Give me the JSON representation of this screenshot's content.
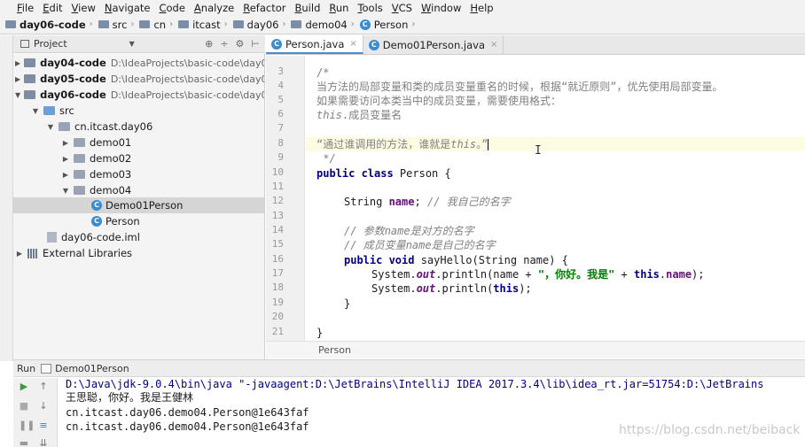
{
  "menu": [
    "File",
    "Edit",
    "View",
    "Navigate",
    "Code",
    "Analyze",
    "Refactor",
    "Build",
    "Run",
    "Tools",
    "VCS",
    "Window",
    "Help"
  ],
  "breadcrumb": [
    "day06-code",
    "src",
    "cn",
    "itcast",
    "day06",
    "demo04",
    "Person"
  ],
  "project_panel": {
    "title": "Project"
  },
  "tree": [
    {
      "label": "day04-code",
      "path": "D:\\IdeaProjects\\basic-code\\day04-co"
    },
    {
      "label": "day05-code",
      "path": "D:\\IdeaProjects\\basic-code\\day05-co"
    },
    {
      "label": "day06-code",
      "path": "D:\\IdeaProjects\\basic-code\\day06-co"
    },
    {
      "label": "src"
    },
    {
      "label": "cn.itcast.day06"
    },
    {
      "label": "demo01"
    },
    {
      "label": "demo02"
    },
    {
      "label": "demo03"
    },
    {
      "label": "demo04"
    },
    {
      "label": "Demo01Person"
    },
    {
      "label": "Person"
    },
    {
      "label": "day06-code.iml"
    },
    {
      "label": "External Libraries"
    }
  ],
  "tabs": [
    {
      "label": "Person.java",
      "close": "×"
    },
    {
      "label": "Demo01Person.java",
      "close": "×"
    }
  ],
  "line_numbers": [
    "3",
    "4",
    "5",
    "6",
    "7",
    "8",
    "9",
    "10",
    "11",
    "12",
    "13",
    "14",
    "15",
    "16",
    "17",
    "18",
    "19",
    "20",
    "21"
  ],
  "code": {
    "l3": "/*",
    "l4": "当方法的局部变量和类的成员变量重名的时候，根据“就近原则”，优先使用局部变量。",
    "l5": "如果需要访问本类当中的成员变量，需要使用格式：",
    "l6_kw": "this",
    "l6_rest": ".成员变量名",
    "l8_a": "“通过谁调用的方法，谁就是",
    "l8_kw": "this",
    "l8_b": "。”",
    "l9": " */",
    "l10_kw": "public class",
    "l10_rest": " Person {",
    "l12_type": "String ",
    "l12_field": "name",
    "l12_rest": "; ",
    "l12_cm": "// 我自己的名字",
    "l14_a": "// 参数",
    "l14_i": "name",
    "l14_b": "是对方的名字",
    "l15_a": "// 成员变量",
    "l15_i": "name",
    "l15_b": "是自己的名字",
    "l16_kw": "public void",
    "l16_rest": " sayHello(String name) {",
    "l17_a": "System.",
    "l17_out": "out",
    "l17_b": ".println(name + ",
    "l17_str": "\"，你好。我是\"",
    "l17_c": " + ",
    "l17_kw": "this",
    "l17_d": ".",
    "l17_field": "name",
    "l17_e": ");",
    "l18_a": "System.",
    "l18_out": "out",
    "l18_b": ".println(",
    "l18_kw": "this",
    "l18_c": ");",
    "l19": "}",
    "l21": "}"
  },
  "editor_breadcrumb": "Person",
  "run": {
    "label": "Run",
    "config": "Demo01Person",
    "output": [
      "D:\\Java\\jdk-9.0.4\\bin\\java \"-javaagent:D:\\JetBrains\\IntelliJ IDEA 2017.3.4\\lib\\idea_rt.jar=51754:D:\\JetBrains",
      "王思聪，你好。我是王健林",
      "cn.itcast.day06.demo04.Person@1e643faf",
      "cn.itcast.day06.demo04.Person@1e643faf"
    ]
  },
  "watermark": "https://blog.csdn.net/beiback",
  "colors": {
    "keyword": "#000080",
    "field": "#660e7a",
    "string": "#008000",
    "comment": "#808080",
    "selection": "#d5d5d5",
    "accent": "#4b8bd4"
  }
}
